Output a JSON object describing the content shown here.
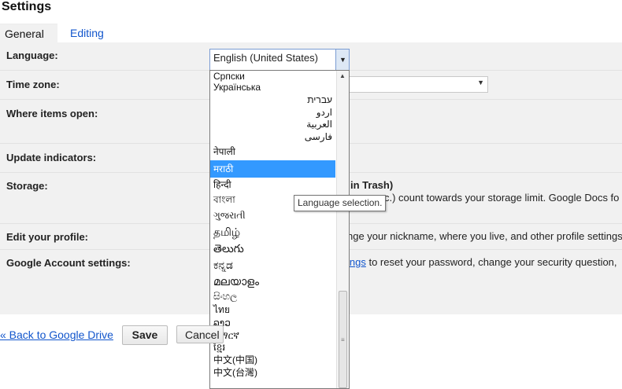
{
  "page": {
    "title": "Settings"
  },
  "tabs": [
    {
      "label": "General",
      "active": true
    },
    {
      "label": "Editing",
      "active": false
    }
  ],
  "settings": {
    "language_label": "Language:",
    "language_value": "English (United States)",
    "timezone_label": "Time zone:",
    "where_items_open_label": "Where items open:",
    "update_indicators_label": "Update indicators:",
    "storage_label": "Storage:",
    "storage_text_1": "in Trash)",
    "storage_text_2": "c.) count towards your storage limit. Google Docs fo",
    "edit_profile_label": "Edit your profile:",
    "edit_profile_text": "nge your nickname, where you live, and other profile settings",
    "account_label": "Google Account settings:",
    "account_link": "ings",
    "account_text": " to reset your password, change your security question,"
  },
  "language_dropdown": {
    "items": [
      "Српски",
      "Українська",
      "עברית",
      "اردو",
      "العربية",
      "فارسی",
      "नेपाली",
      "मराठी",
      "हिन्दी",
      "বাংলা",
      "ગુજરાતી",
      "தமிழ்",
      "తెలుగు",
      "ಕನ್ನಡ",
      "മലയാളം",
      "සිංහල",
      "ไทย",
      "ລາວ",
      "አማርኛ",
      "ខ្មែរ",
      "中文(中国)",
      "中文(台灣)"
    ],
    "selected_index": 7
  },
  "tooltip": {
    "text": "Language selection."
  },
  "footer": {
    "back_link": "« Back to Google Drive",
    "save_label": "Save",
    "cancel_label": "Cancel"
  },
  "colors": {
    "link": "#1155cc",
    "selection": "#3399ff",
    "panel_bg": "#f1f1f1"
  }
}
